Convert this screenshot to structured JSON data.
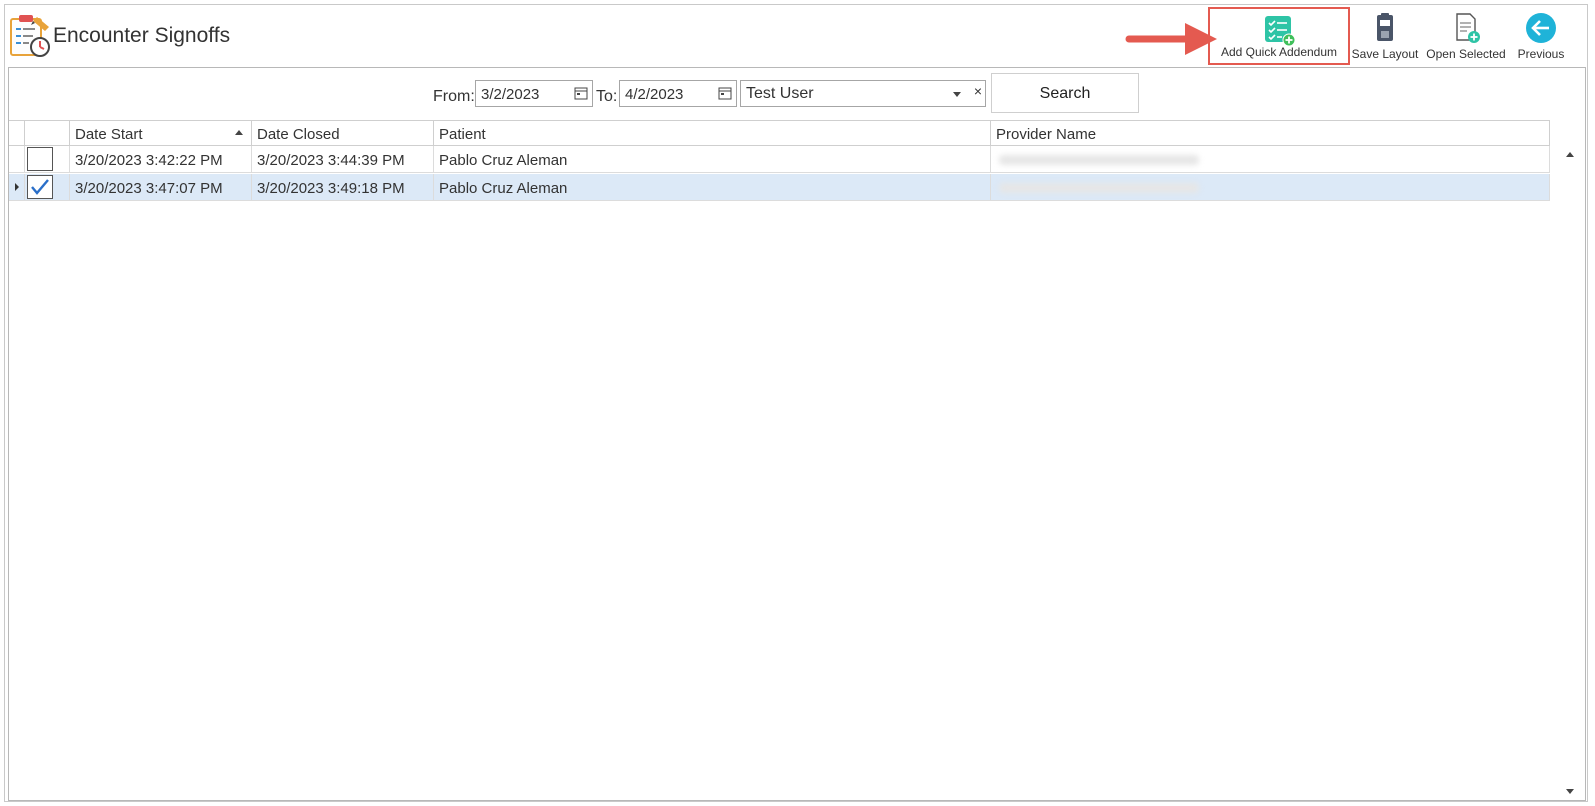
{
  "header": {
    "title": "Encounter Signoffs",
    "toolbar": [
      {
        "label": "Add Quick Addendum",
        "icon": "checklist-add-icon"
      },
      {
        "label": "Save Layout",
        "icon": "clipboard-save-icon"
      },
      {
        "label": "Open Selected",
        "icon": "document-add-icon"
      },
      {
        "label": "Previous",
        "icon": "back-arrow-icon"
      }
    ]
  },
  "filter": {
    "from_label": "From:",
    "from_value": "3/2/2023",
    "to_label": "To:",
    "to_value": "4/2/2023",
    "user_value": "Test User",
    "clear_glyph": "×",
    "search_label": "Search"
  },
  "grid": {
    "columns": [
      "Date Start",
      "Date Closed",
      "Patient",
      "Provider Name"
    ],
    "rows": [
      {
        "checked": false,
        "date_start": "3/20/2023 3:42:22 PM",
        "date_closed": "3/20/2023 3:44:39 PM",
        "patient": "Pablo Cruz Aleman"
      },
      {
        "checked": true,
        "date_start": "3/20/2023 3:47:07 PM",
        "date_closed": "3/20/2023 3:49:18 PM",
        "patient": "Pablo Cruz Aleman"
      }
    ]
  },
  "colors": {
    "highlight_border": "#e45a50",
    "selected_row": "#dce9f7",
    "accent_teal": "#2ec4a6",
    "accent_blue": "#1aa3d8",
    "check_blue": "#2a6fc9"
  }
}
